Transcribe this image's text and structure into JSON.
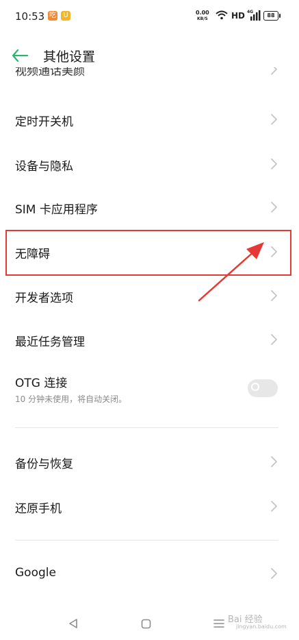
{
  "status_bar": {
    "time": "10:53",
    "notif1": "吃",
    "notif2": "U",
    "net_speed_value": "0.00",
    "net_speed_unit": "KB/S",
    "hd": "HD",
    "signal_label": "4G",
    "battery": "88"
  },
  "header": {
    "title": "其他设置"
  },
  "settings": {
    "clipped_item": "视频通话美颜",
    "items": [
      {
        "label": "定时开关机"
      },
      {
        "label": "设备与隐私"
      },
      {
        "label": "SIM 卡应用程序"
      },
      {
        "label": "无障碍"
      },
      {
        "label": "开发者选项"
      },
      {
        "label": "最近任务管理"
      }
    ],
    "otg": {
      "label": "OTG 连接",
      "description": "10 分钟未使用，将自动关闭。",
      "enabled": false
    },
    "group2": [
      {
        "label": "备份与恢复"
      },
      {
        "label": "还原手机"
      }
    ],
    "group3": [
      {
        "label": "Google"
      }
    ]
  },
  "watermark": {
    "text": "Bai 经验",
    "sub": "jingyan.baidu.com"
  },
  "colors": {
    "accent": "#2db36f",
    "highlight": "#e53935",
    "divider": "#e6e6e6"
  }
}
